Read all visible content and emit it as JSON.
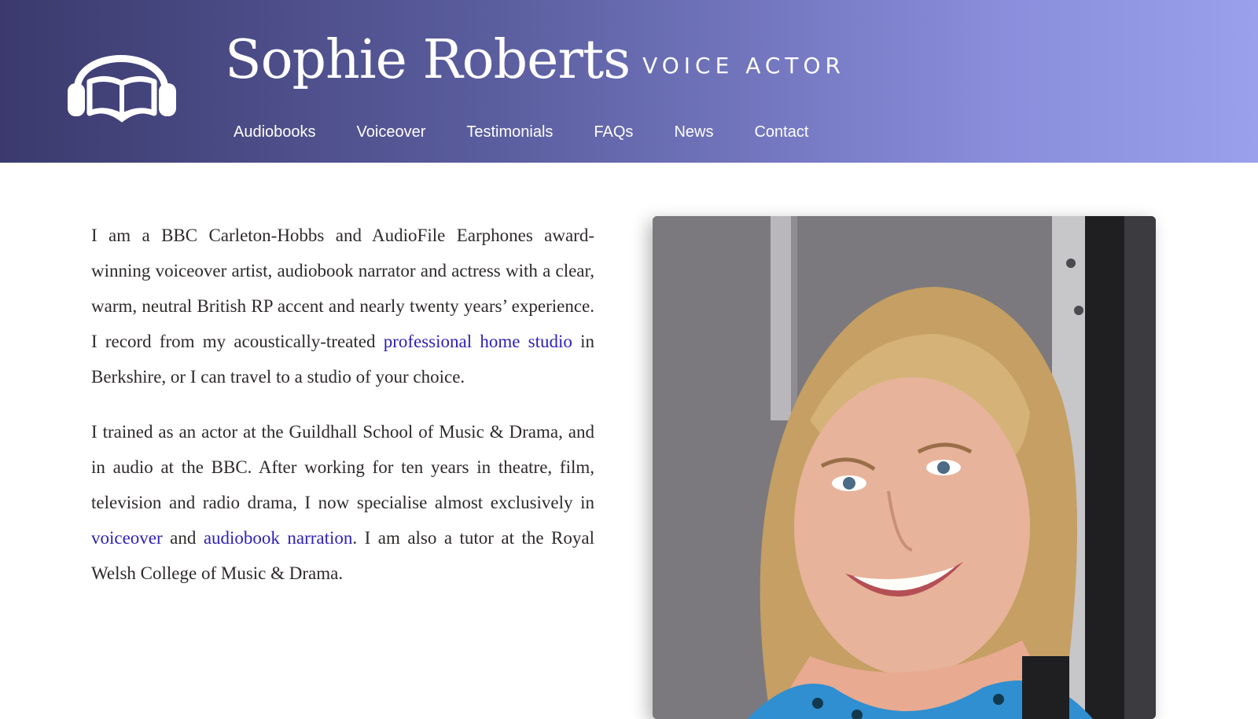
{
  "site": {
    "name": "Sophie Roberts",
    "tagline": "VOICE ACTOR",
    "logo_icon": "headphones-book-icon"
  },
  "nav": {
    "items": [
      {
        "label": "Audiobooks"
      },
      {
        "label": "Voiceover"
      },
      {
        "label": "Testimonials"
      },
      {
        "label": "FAQs"
      },
      {
        "label": "News"
      },
      {
        "label": "Contact"
      }
    ]
  },
  "intro": {
    "p1": {
      "t1": "I am a BBC Carleton-Hobbs and AudioFile Earphones award-winning voiceover artist, audiobook narrator and actress with a clear, warm, neutral British RP accent and nearly twenty years’ experience. I record from my acoustically-treated ",
      "link": "professional home studio",
      "t2": " in Berkshire, or I can travel to a studio of your choice."
    },
    "p2": {
      "t1": "I trained as an actor at the Guildhall School of Music & Drama, and in audio at the BBC. After working for ten years in theatre, film, television and radio drama, I now specialise almost exclusively in ",
      "link1": "voiceover",
      "t2": " and ",
      "link2": "audiobook narration",
      "t3": ". I am also a tutor at the Royal Welsh College of Music & Drama."
    }
  },
  "colors": {
    "header_start": "#3b3a6e",
    "header_end": "#9aa0ec",
    "link": "#2d1fb8",
    "body_text": "#2f2a2a"
  }
}
